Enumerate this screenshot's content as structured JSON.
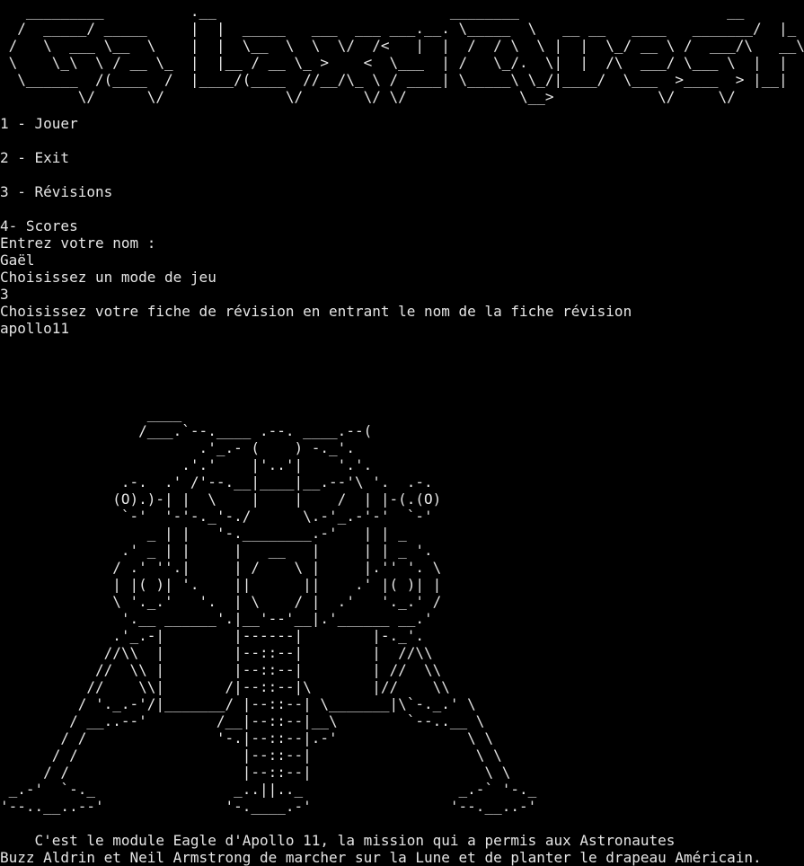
{
  "terminal": {
    "title_banner": "   _________          .__                           ________                        __   \n  /  _____/ _____     |  |  _____   ___  ___ ___.__. \\_____  \\   __ __   ____   _______/  |_ \n /   \\  ___ \\__  \\    |  |  \\__  \\  \\  \\/  /<   |  |  /  / \\  \\ |  |  \\_/ __ \\ /  ___/\\   __\\\n \\    \\_\\  \\ / __ \\_  |  |__ / __ \\_ >    <  \\___  | /   \\_/.  \\|  |  /\\  ___/ \\___ \\  |  |  \n  \\______  /(____  /  |____/(____  //__/\\_ \\ / ____| \\_____\\ \\_/|____/  \\___  >____  > |__|  \n         \\/      \\/              \\/       \\/ \\/             \\__>            \\/     \\/        ",
    "menu": [
      "1 - Jouer",
      "2 - Exit",
      "3 - Révisions",
      "4- Scores"
    ],
    "session": [
      "Entrez votre nom :",
      "Gaël",
      "Choisissez un mode de jeu",
      "3",
      "Choisissez votre fiche de révision en entrant le nom de la fiche révision",
      "apollo11"
    ],
    "lunar_module_art": "                 ____\n                /___.`--.____ .--. ____.--(\n                       .'_.- (    ) -._'.\n                     .'.'    |'..'|    '.'.\n              .-.  .' /'--.__|____|__.--'\\ '.  .-.\n             (O).)-| |  \\    |    |    /  | |-(.(O)\n              `-'  '-'-._'-./      \\.-'_.-'-'  `-'\n                 _ | |   '-.________.-'   | | _\n              .' _ | |     |   __   |     | | _ '.\n             / .' ''.|     | /    \\ |     |.'' '. \\\n             | |( )| '.    ||      ||    .' |( )| |\n             \\ '._.'   '.  | \\    / |  .'   '._.' /\n              '.__ ______'.|__'--'__|.'______ __.'\n             .'_.-|        |------|        |-._'.\n            //\\\\  |        |--::--|        |  //\\\\\n           //  \\\\ |        |--::--|        | //  \\\\\n          //    \\\\|       /|--::--|\\       |//    \\\\\n         / '._.-'/|_______/ |--::--| \\_______|\\`-._.' \\\n        / __..--'        /__|--::--|__\\        `--..__ \\\n       / /               '-.|--::--|.-'               \\ \\\n      / /                   |--::--|                   \\ \\\n     / /                    |--::--|                    \\ \\\n _.-'  `-._                _..||.._                  _.-` '-._\n'--..__..--'              '-.____.-'                '--.__..-'",
    "caption": [
      "    C'est le module Eagle d'Apollo 11, la mission qui a permis aux Astronautes",
      "Buzz Aldrin et Neil Armstrong de marcher sur la Lune et de planter le drapeau Américain."
    ],
    "colors": {
      "background": "#000000",
      "text": "#e6e6e6"
    }
  }
}
